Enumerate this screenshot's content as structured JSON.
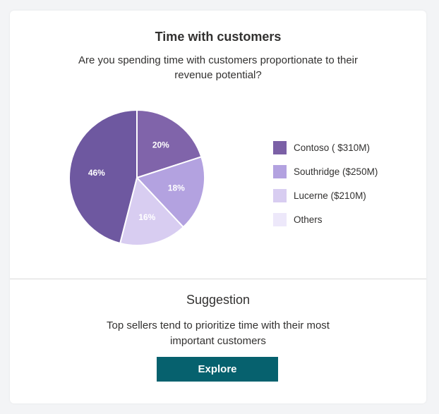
{
  "card": {
    "title": "Time with customers",
    "subtitle": "Are you spending time with customers proportionate to their revenue potential?"
  },
  "chart_data": {
    "type": "pie",
    "slices": [
      {
        "label": "Contoso ( $310M)",
        "value": 20,
        "display": "20%",
        "color": "#8064aa"
      },
      {
        "label": "Southridge ($250M)",
        "value": 18,
        "display": "18%",
        "color": "#b3a2e0"
      },
      {
        "label": "Lucerne  ($210M)",
        "value": 16,
        "display": "16%",
        "color": "#d8cdf1"
      },
      {
        "label": "Others",
        "value": 46,
        "display": "46%",
        "color": "#6e58a0"
      }
    ],
    "legend": [
      {
        "label": "Contoso ( $310M)",
        "color": "#7b60a6"
      },
      {
        "label": "Southridge ($250M)",
        "color": "#b3a2e0"
      },
      {
        "label": "Lucerne  ($210M)",
        "color": "#d8cdf1"
      },
      {
        "label": "Others",
        "color": "#ede8fa"
      }
    ],
    "legend_position": "right"
  },
  "suggestion": {
    "title": "Suggestion",
    "text": "Top sellers tend to prioritize time with their most important customers",
    "button_label": "Explore",
    "button_color": "#06616e"
  }
}
